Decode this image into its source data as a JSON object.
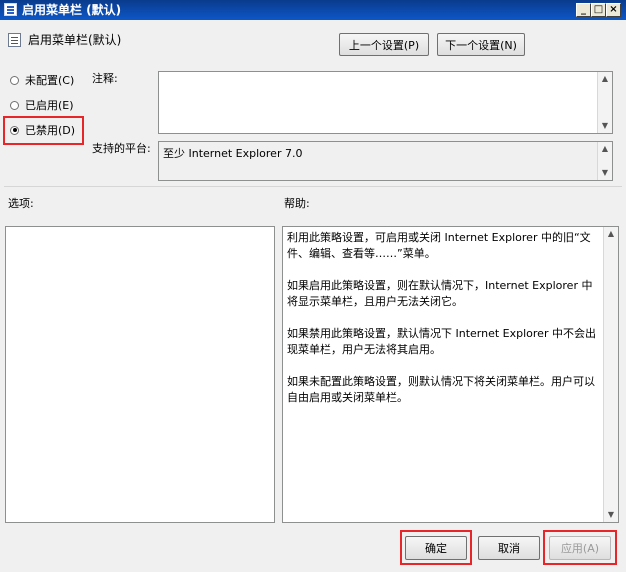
{
  "window": {
    "title": "启用菜单栏 (默认)"
  },
  "header": {
    "policy_title": "启用菜单栏(默认)",
    "prev_label": "上一个设置(P)",
    "next_label": "下一个设置(N)"
  },
  "state": {
    "options": [
      {
        "label": "未配置(C)",
        "checked": false
      },
      {
        "label": "已启用(E)",
        "checked": false
      },
      {
        "label": "已禁用(D)",
        "checked": true
      }
    ]
  },
  "comment": {
    "label": "注释:",
    "value": ""
  },
  "platform": {
    "label": "支持的平台:",
    "value": "至少 Internet Explorer 7.0"
  },
  "options_section": {
    "label": "选项:"
  },
  "help_section": {
    "label": "帮助:",
    "paragraphs": [
      "利用此策略设置，可启用或关闭 Internet Explorer 中的旧“文件、编辑、查看等……”菜单。",
      "如果启用此策略设置，则在默认情况下，Internet Explorer 中将显示菜单栏，且用户无法关闭它。",
      "如果禁用此策略设置，默认情况下 Internet Explorer 中不会出现菜单栏，用户无法将其启用。",
      "如果未配置此策略设置，则默认情况下将关闭菜单栏。用户可以自由启用或关闭菜单栏。"
    ]
  },
  "footer": {
    "ok_label": "确定",
    "cancel_label": "取消",
    "apply_label": "应用(A)"
  },
  "colors": {
    "highlight": "#e8262a",
    "title_bar": "#0d57c8"
  }
}
